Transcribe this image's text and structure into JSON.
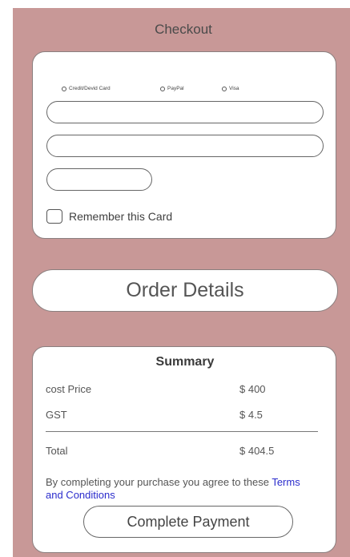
{
  "header": {
    "title": "Checkout"
  },
  "payment": {
    "methods": [
      {
        "label": "Credit/Devid Card"
      },
      {
        "label": "PayPal"
      },
      {
        "label": "Visa"
      }
    ],
    "fields": [
      {
        "value": "",
        "placeholder": ""
      },
      {
        "value": "",
        "placeholder": ""
      },
      {
        "value": "",
        "placeholder": ""
      }
    ],
    "remember_label": "Remember this Card",
    "remember_checked": false
  },
  "order": {
    "button_label": "Order Details"
  },
  "summary": {
    "title": "Summary",
    "rows": [
      {
        "label": "cost Price",
        "value": "$ 400"
      },
      {
        "label": "GST",
        "value": "$ 4.5"
      }
    ],
    "total": {
      "label": "Total",
      "value": "$ 404.5"
    },
    "notice_prefix": "By completing your purchase you agree to these ",
    "terms_link": "Terms and Conditions",
    "complete_button": "Complete Payment"
  },
  "colors": {
    "background": "#c89897",
    "card": "#ffffff",
    "link": "#2b2ccc"
  }
}
